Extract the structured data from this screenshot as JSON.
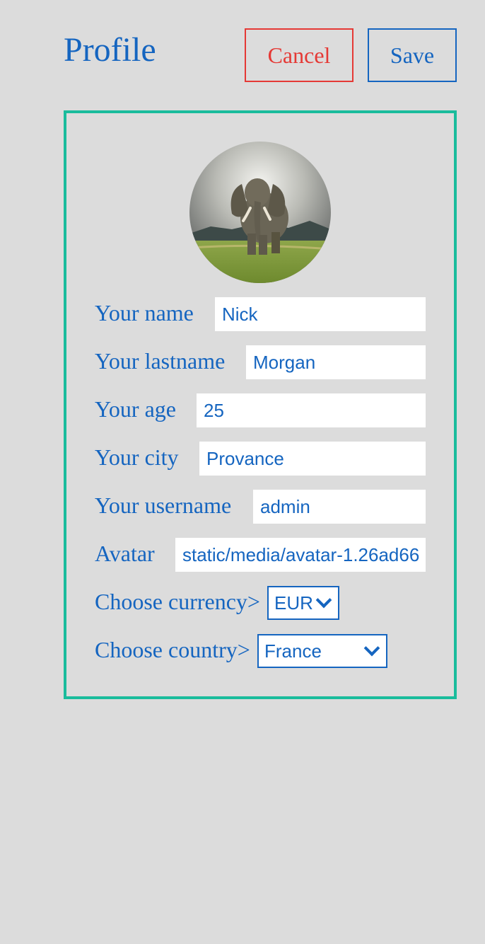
{
  "header": {
    "title": "Profile",
    "cancel_label": "Cancel",
    "save_label": "Save"
  },
  "form": {
    "name": {
      "label": "Your name",
      "value": "Nick"
    },
    "lastname": {
      "label": "Your lastname",
      "value": "Morgan"
    },
    "age": {
      "label": "Your age",
      "value": "25"
    },
    "city": {
      "label": "Your city",
      "value": "Provance"
    },
    "username": {
      "label": "Your username",
      "value": "admin"
    },
    "avatar": {
      "label": "Avatar",
      "value": "static/media/avatar-1.26ad66"
    },
    "currency": {
      "label": "Choose currency>",
      "selected": "EUR"
    },
    "country": {
      "label": "Choose country>",
      "selected": "France"
    }
  },
  "colors": {
    "primary_text": "#1565c0",
    "cancel": "#e53935",
    "card_border": "#1abc9c",
    "background": "#dcdcdc"
  },
  "icons": {
    "avatar_image": "elephant-photo",
    "select_arrow": "chevron-down-icon"
  }
}
